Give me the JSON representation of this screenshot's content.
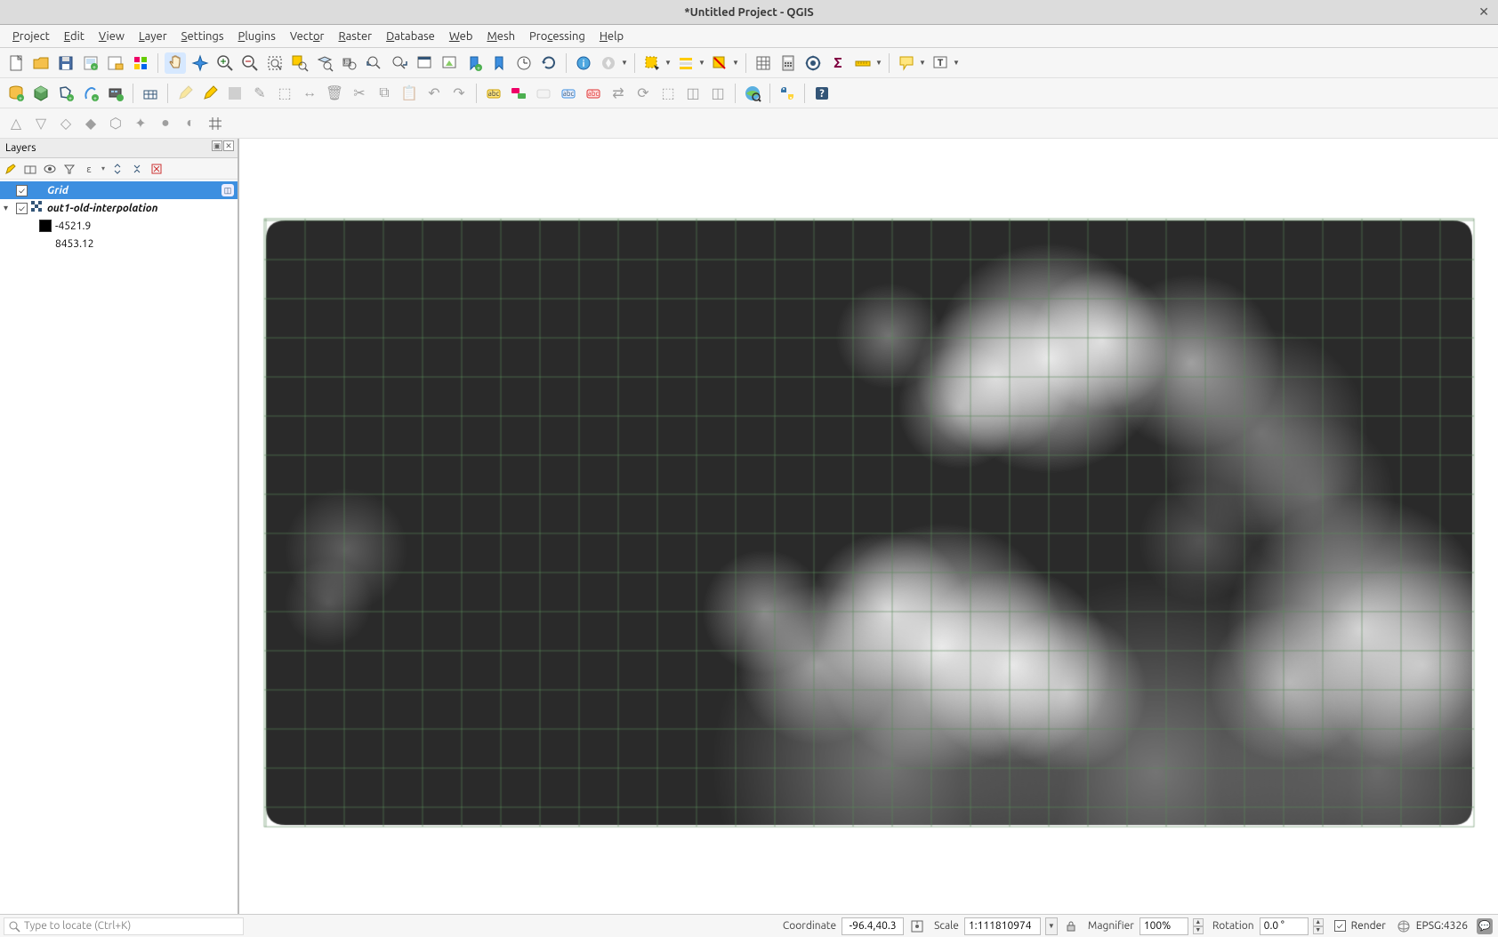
{
  "window": {
    "title": "*Untitled Project - QGIS"
  },
  "menu": {
    "project": "Project",
    "edit": "Edit",
    "view": "View",
    "layer": "Layer",
    "settings": "Settings",
    "plugins": "Plugins",
    "vector": "Vector",
    "raster": "Raster",
    "database": "Database",
    "web": "Web",
    "mesh": "Mesh",
    "processing": "Processing",
    "help": "Help"
  },
  "layers_panel": {
    "title": "Layers",
    "grid": "Grid",
    "interp": "out1-old-interpolation",
    "val_min": "-4521.9",
    "val_max": "8453.12"
  },
  "locator": {
    "placeholder": "Type to locate (Ctrl+K)"
  },
  "status": {
    "coordinate_label": "Coordinate",
    "coordinate": "-96.4,40.3",
    "scale_label": "Scale",
    "scale": "1:111810974",
    "magnifier_label": "Magnifier",
    "magnifier": "100%",
    "rotation_label": "Rotation",
    "rotation": "0.0 °",
    "render": "Render",
    "crs": "EPSG:4326"
  }
}
